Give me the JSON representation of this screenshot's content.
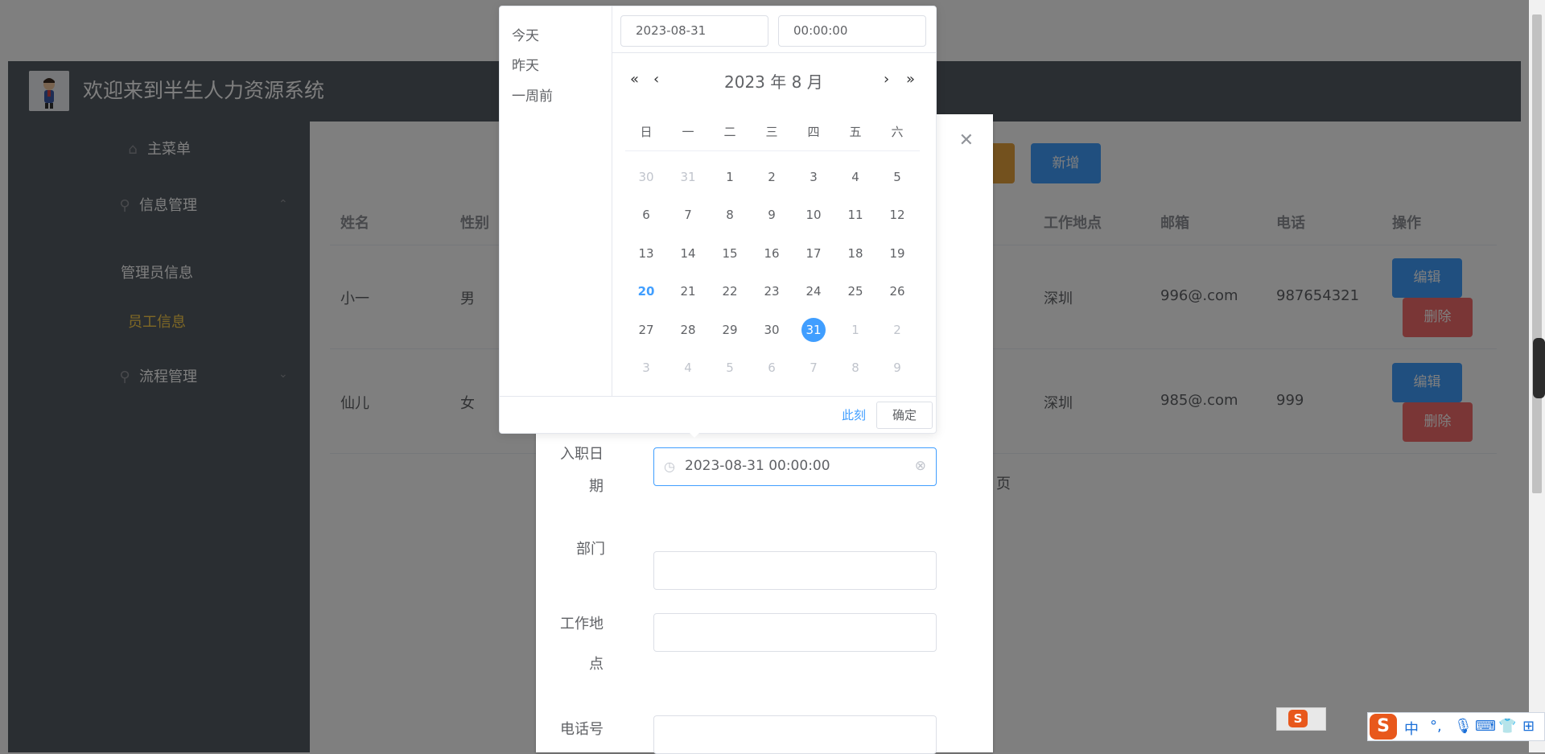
{
  "header": {
    "title": "欢迎来到半生人力资源系统"
  },
  "sidebar": {
    "items": [
      {
        "label": "主菜单",
        "icon": "home-icon"
      },
      {
        "label": "信息管理",
        "icon": "location-icon"
      },
      {
        "label": "管理员信息"
      },
      {
        "label": "员工信息"
      },
      {
        "label": "流程管理",
        "icon": "location-icon"
      }
    ],
    "active_color": "#ffd04b"
  },
  "toolbar": {
    "add_label": "新增"
  },
  "table": {
    "columns": [
      "姓名",
      "性别",
      "工作地点",
      "邮箱",
      "电话",
      "操作"
    ],
    "rows": [
      {
        "name": "小一",
        "gender": "男",
        "location": "深圳",
        "email": "996@.com",
        "phone": "987654321"
      },
      {
        "name": "仙儿",
        "gender": "女",
        "location": "深圳",
        "email": "985@.com",
        "phone": "999"
      }
    ],
    "edit_label": "编辑",
    "delete_label": "删除",
    "pagination_suffix": "页"
  },
  "dialog": {
    "fields": [
      {
        "label_line1": "入职日",
        "label_line2": "期",
        "value": "2023-08-31 00:00:00"
      },
      {
        "label_line1": "部门",
        "value": ""
      },
      {
        "label_line1": "工作地",
        "label_line2": "点",
        "value": ""
      },
      {
        "label_line1": "电话号",
        "value": ""
      }
    ]
  },
  "picker": {
    "shortcuts": [
      "今天",
      "昨天",
      "一周前"
    ],
    "date_value": "2023-08-31",
    "time_value": "00:00:00",
    "month_label": "2023 年  8 月",
    "weekdays": [
      "日",
      "一",
      "二",
      "三",
      "四",
      "五",
      "六"
    ],
    "days": [
      [
        "30",
        "31",
        "1",
        "2",
        "3",
        "4",
        "5"
      ],
      [
        "6",
        "7",
        "8",
        "9",
        "10",
        "11",
        "12"
      ],
      [
        "13",
        "14",
        "15",
        "16",
        "17",
        "18",
        "19"
      ],
      [
        "20",
        "21",
        "22",
        "23",
        "24",
        "25",
        "26"
      ],
      [
        "27",
        "28",
        "29",
        "30",
        "31",
        "1",
        "2"
      ],
      [
        "3",
        "4",
        "5",
        "6",
        "7",
        "8",
        "9"
      ]
    ],
    "today": "20",
    "selected": "31",
    "now_label": "此刻",
    "confirm_label": "确定",
    "accent": "#409eff"
  },
  "ime": {
    "lang": "中"
  }
}
